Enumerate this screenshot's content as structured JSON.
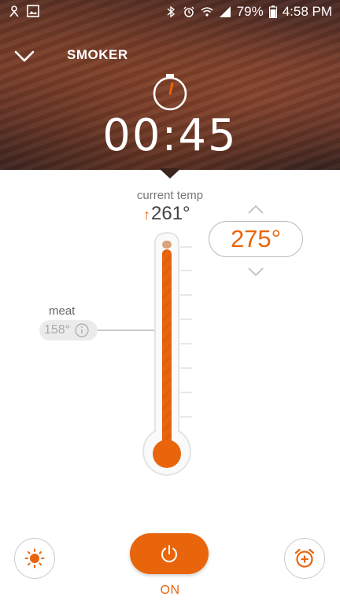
{
  "status_bar": {
    "battery": "79%",
    "time": "4:58 PM",
    "icons": [
      "notification-icon",
      "gallery-icon",
      "bluetooth-icon",
      "alarm-icon",
      "wifi-icon",
      "signal-icon",
      "battery-icon"
    ]
  },
  "header": {
    "title": "SMOKER",
    "timer": "00:45"
  },
  "current_temp": {
    "label": "current temp",
    "value": "261°",
    "trend": "↑"
  },
  "target_temp": {
    "value": "275°"
  },
  "probe": {
    "label": "meat",
    "value": "158°"
  },
  "thermometer": {
    "fill_fraction": 0.95
  },
  "power": {
    "label": "ON"
  },
  "colors": {
    "accent": "#e8650c",
    "light_accent": "#d9a27a"
  }
}
